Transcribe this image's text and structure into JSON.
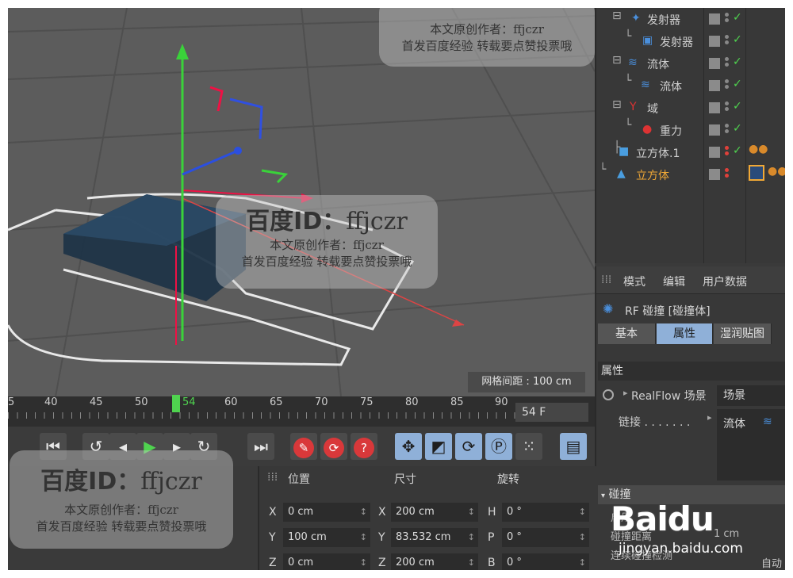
{
  "viewport": {
    "grid_readout": "网格间距 : 100 cm"
  },
  "object_manager": {
    "objects": [
      {
        "label": "发射器",
        "icon": "emitter-icon",
        "state": "green"
      },
      {
        "label": "发射器",
        "icon": "emitter-child-icon",
        "state": "green"
      },
      {
        "label": "流体",
        "icon": "fluid-icon",
        "state": "green"
      },
      {
        "label": "流体",
        "icon": "fluid-child-icon",
        "state": "green"
      },
      {
        "label": "域",
        "icon": "domain-icon",
        "state": "green"
      },
      {
        "label": "重力",
        "icon": "gravity-icon",
        "state": "green"
      },
      {
        "label": "立方体.1",
        "icon": "cube-icon",
        "state": "red-green"
      },
      {
        "label": "立方体",
        "icon": "cone-icon",
        "state": "red",
        "selected": true
      }
    ]
  },
  "attributes": {
    "menu": [
      "模式",
      "编辑",
      "用户数据"
    ],
    "title": "RF 碰撞 [碰撞体]",
    "tabs": [
      "基本",
      "属性",
      "湿润贴图"
    ],
    "active_tab": "属性",
    "section_props": "属性",
    "realflow_scene_label": "RealFlow 场景",
    "realflow_scene_value": "场景",
    "link_label": "链接 . . . . . . .",
    "link_value": "流体",
    "section_collision": "碰撞",
    "collision_items": [
      "启用",
      "碰撞距离",
      "连续碰撞检测"
    ],
    "collision_value": "1 cm",
    "auto_label": "自动"
  },
  "timeline": {
    "ticks": [
      "5",
      "40",
      "45",
      "50",
      "54",
      "60",
      "65",
      "70",
      "75",
      "80",
      "85",
      "90"
    ],
    "current": "54",
    "frame_field": "54 F"
  },
  "coordinates": {
    "headers": [
      "位置",
      "尺寸",
      "旋转"
    ],
    "rows": [
      {
        "axis": "X",
        "pos": "0 cm",
        "size_axis": "X",
        "size": "200 cm",
        "rot_axis": "H",
        "rot": "0 °"
      },
      {
        "axis": "Y",
        "pos": "100 cm",
        "size_axis": "Y",
        "size": "83.532 cm",
        "rot_axis": "P",
        "rot": "0 °"
      },
      {
        "axis": "Z",
        "pos": "0 cm",
        "size_axis": "Z",
        "size": "200 cm",
        "rot_axis": "B",
        "rot": "0 °"
      }
    ]
  },
  "watermarks": {
    "big": "百度ID：",
    "id": "ffjczr",
    "line1": "本文原创作者：ffjczr",
    "line2": "首发百度经验 转载要点赞投票哦"
  },
  "baidu": {
    "logo": "Baidu",
    "url": "jingyan.baidu.com"
  }
}
